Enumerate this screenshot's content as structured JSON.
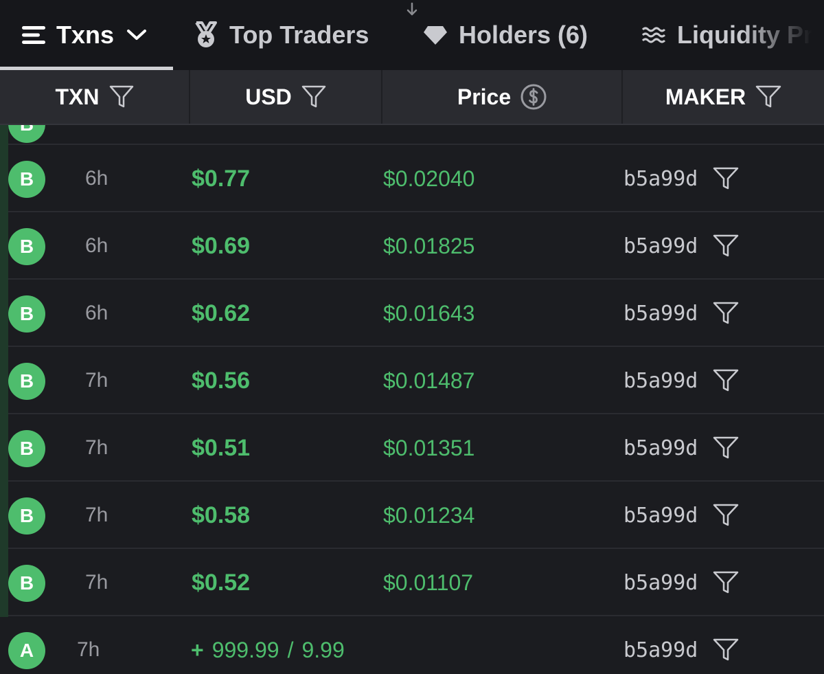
{
  "tabs": {
    "txns": "Txns",
    "top_traders": "Top Traders",
    "holders": "Holders (6)",
    "liquidity": "Liquidity Pr"
  },
  "columns": {
    "txn": "TXN",
    "usd": "USD",
    "price": "Price",
    "maker": "MAKER"
  },
  "colors": {
    "buy": "#4ebd6d",
    "background": "#1b1c20",
    "header": "#2a2b30"
  },
  "rows": [
    {
      "type": "B",
      "age": "6h",
      "usd": "$0.77",
      "price": "$0.02040",
      "maker": "b5a99d"
    },
    {
      "type": "B",
      "age": "6h",
      "usd": "$0.69",
      "price": "$0.01825",
      "maker": "b5a99d"
    },
    {
      "type": "B",
      "age": "6h",
      "usd": "$0.62",
      "price": "$0.01643",
      "maker": "b5a99d"
    },
    {
      "type": "B",
      "age": "7h",
      "usd": "$0.56",
      "price": "$0.01487",
      "maker": "b5a99d"
    },
    {
      "type": "B",
      "age": "7h",
      "usd": "$0.51",
      "price": "$0.01351",
      "maker": "b5a99d"
    },
    {
      "type": "B",
      "age": "7h",
      "usd": "$0.58",
      "price": "$0.01234",
      "maker": "b5a99d"
    },
    {
      "type": "B",
      "age": "7h",
      "usd": "$0.52",
      "price": "$0.01107",
      "maker": "b5a99d"
    }
  ],
  "liquidity_row": {
    "type": "A",
    "age": "7h",
    "plus": "+",
    "amount_a": "999.99",
    "separator": "/",
    "amount_b": "9.99",
    "maker": "b5a99d"
  }
}
